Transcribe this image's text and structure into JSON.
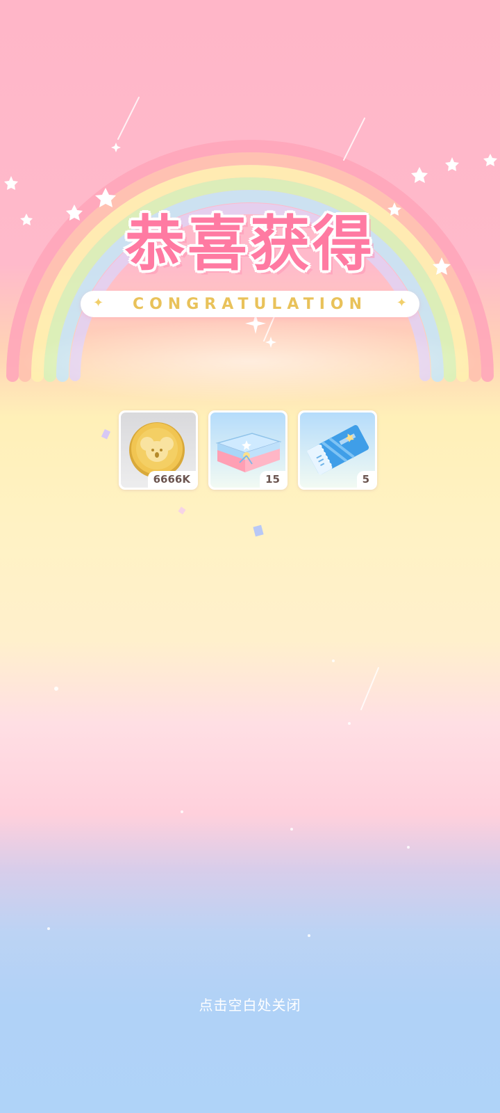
{
  "title": "恭喜获得",
  "subtitle": "CONGRATULATION",
  "banner_decor_icons": [
    "sparkle-icon",
    "sparkle-icon"
  ],
  "rewards": [
    {
      "item": "koala-coin-icon",
      "count": "6666K"
    },
    {
      "item": "gift-box-icon",
      "count": "15"
    },
    {
      "item": "ticket-icon",
      "count": "5"
    }
  ],
  "close_hint": "点击空白处关闭",
  "colors": {
    "title_pink": "#ff7aa2",
    "subtitle_gold": "#e9c25a",
    "count_text": "#6b5550"
  }
}
